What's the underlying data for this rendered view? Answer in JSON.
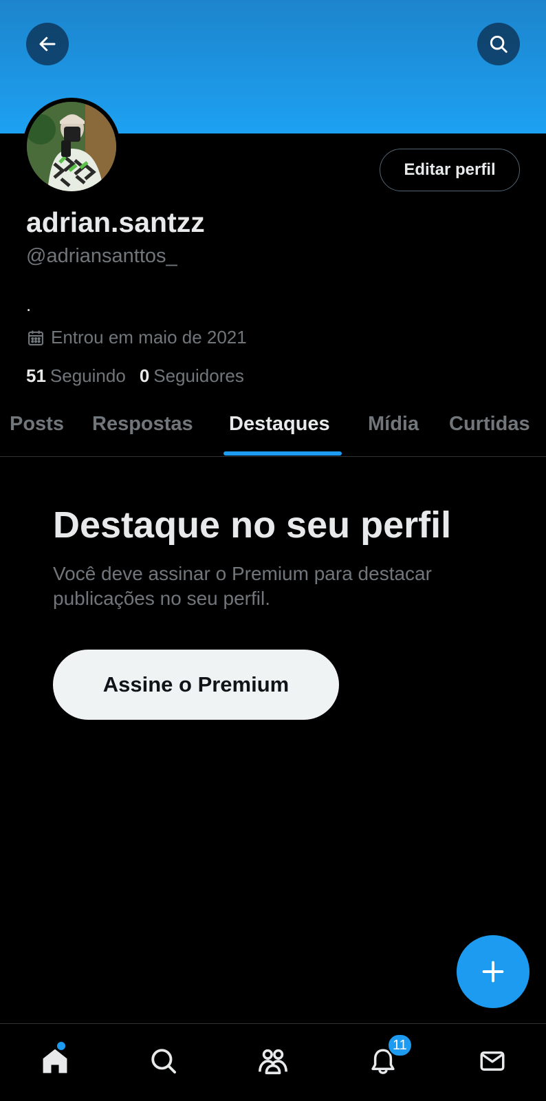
{
  "header": {
    "back_icon": "arrow-left-icon",
    "search_icon": "search-icon"
  },
  "profile": {
    "display_name": "adrian.santzz",
    "handle": "@adriansanttos_",
    "bio": ".",
    "joined": "Entrou em maio de 2021",
    "edit_label": "Editar perfil",
    "following_count": "51",
    "following_label": "Seguindo",
    "followers_count": "0",
    "followers_label": "Seguidores"
  },
  "tabs": [
    {
      "label": "Posts"
    },
    {
      "label": "Respostas"
    },
    {
      "label": "Destaques",
      "active": true
    },
    {
      "label": "Mídia"
    },
    {
      "label": "Curtidas"
    }
  ],
  "highlights": {
    "title": "Destaque no seu perfil",
    "text": "Você deve assinar o Premium para destacar publicações no seu perfil.",
    "button_label": "Assine o Premium"
  },
  "bottom_nav": {
    "items": [
      "home-icon",
      "search-icon",
      "communities-icon",
      "notifications-icon",
      "messages-icon"
    ],
    "notifications_badge": "11"
  },
  "colors": {
    "accent": "#1d9bf0",
    "background": "#000000",
    "text_primary": "#e7e9ea",
    "text_secondary": "#71767b"
  }
}
